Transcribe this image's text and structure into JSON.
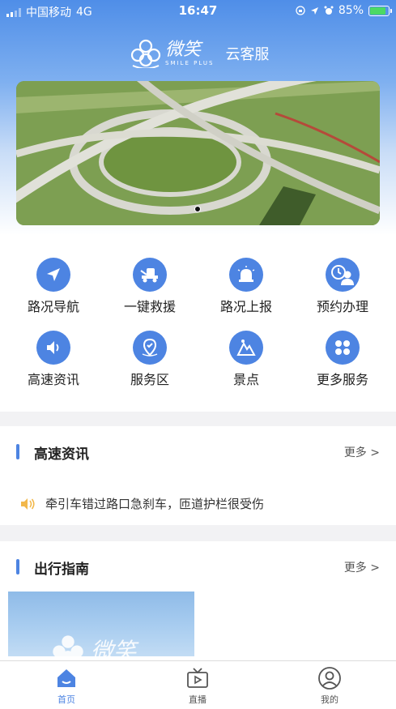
{
  "status_bar": {
    "carrier": "中国移动",
    "network": "4G",
    "time": "16:47",
    "battery_pct": "85%"
  },
  "brand": {
    "logo_cn": "微笑",
    "logo_en": "SMILE PLUS",
    "service": "云客服"
  },
  "banner": {
    "slide_index": 1,
    "slide_count": 1
  },
  "services": [
    {
      "label": "路况导航",
      "icon": "navigation-arrow-icon"
    },
    {
      "label": "一键救援",
      "icon": "tow-truck-icon"
    },
    {
      "label": "路况上报",
      "icon": "alarm-light-icon"
    },
    {
      "label": "预约办理",
      "icon": "person-clock-icon"
    },
    {
      "label": "高速资讯",
      "icon": "speaker-icon"
    },
    {
      "label": "服务区",
      "icon": "map-pin-icon"
    },
    {
      "label": "景点",
      "icon": "mountain-icon"
    },
    {
      "label": "更多服务",
      "icon": "four-dots-icon"
    }
  ],
  "news_section": {
    "title": "高速资讯",
    "more": "更多 >",
    "headline": "牵引车错过路口急刹车，匝道护栏很受伤"
  },
  "guide_section": {
    "title": "出行指南",
    "more": "更多 >"
  },
  "tabs": [
    {
      "label": "首页",
      "icon": "home-icon",
      "active": true
    },
    {
      "label": "直播",
      "icon": "tv-play-icon",
      "active": false
    },
    {
      "label": "我的",
      "icon": "user-icon",
      "active": false
    }
  ],
  "colors": {
    "accent": "#4d84e2",
    "header_top": "#4f8ee8",
    "battery": "#4cd964",
    "speaker": "#f2b84b"
  }
}
